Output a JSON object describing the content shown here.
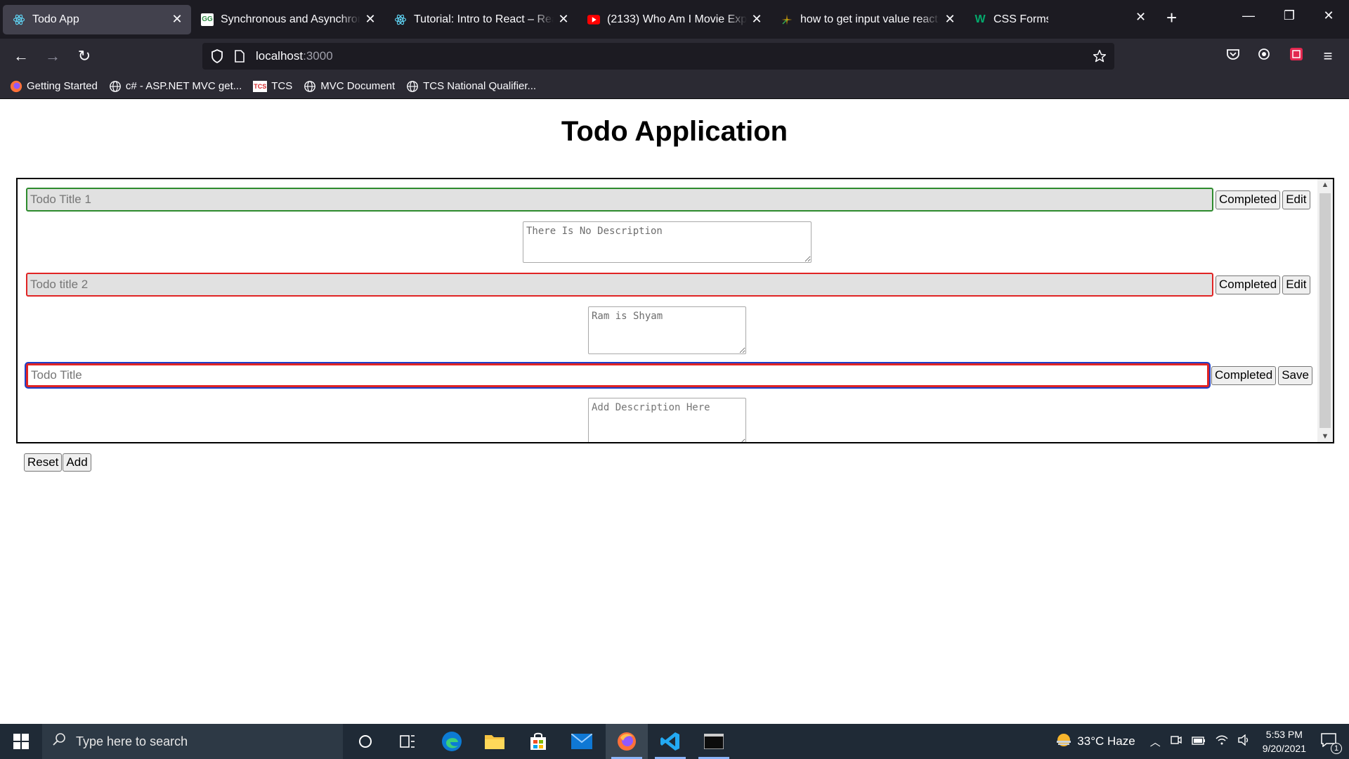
{
  "browser": {
    "tabs": [
      {
        "title": "Todo App",
        "icon": "react-icon",
        "active": true
      },
      {
        "title": "Synchronous and Asynchronous",
        "icon": "gfg-icon"
      },
      {
        "title": "Tutorial: Intro to React – React",
        "icon": "react-icon"
      },
      {
        "title": "(2133) Who Am I Movie Explained",
        "icon": "youtube-icon"
      },
      {
        "title": "how to get input value react js",
        "icon": "spark-icon"
      },
      {
        "title": "CSS Forms",
        "icon": "w3schools-icon"
      }
    ],
    "url_host": "localhost",
    "url_port": ":3000",
    "bookmarks": [
      {
        "label": "Getting Started",
        "icon": "firefox-icon"
      },
      {
        "label": "c# - ASP.NET MVC get...",
        "icon": "globe-icon"
      },
      {
        "label": "TCS",
        "icon": "tcs-icon"
      },
      {
        "label": "MVC Document",
        "icon": "globe-icon"
      },
      {
        "label": "TCS National Qualifier...",
        "icon": "globe-icon"
      }
    ]
  },
  "app": {
    "title": "Todo Application",
    "todos": [
      {
        "title_value": "Todo Title 1",
        "completed_label": "Completed",
        "action_label": "Edit",
        "description": "There Is No Description",
        "state": "done-green"
      },
      {
        "title_value": "Todo title 2",
        "completed_label": "Completed",
        "action_label": "Edit",
        "description": "Ram is Shyam",
        "state": "done-red"
      },
      {
        "title_placeholder": "Todo Title",
        "completed_label": "Completed",
        "action_label": "Save",
        "description_placeholder": "Add Description Here",
        "state": "editing"
      }
    ],
    "reset_label": "Reset",
    "add_label": "Add"
  },
  "taskbar": {
    "search_placeholder": "Type here to search",
    "weather": "33°C Haze",
    "time": "5:53 PM",
    "date": "9/20/2021",
    "notification_count": "1"
  }
}
